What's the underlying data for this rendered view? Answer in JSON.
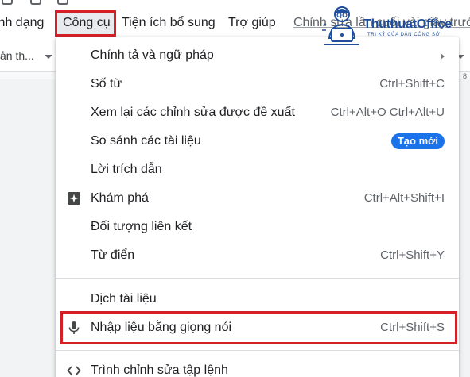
{
  "menubar": {
    "items": [
      "ịnh dạng",
      "Công cụ",
      "Tiện ích bổ sung",
      "Trợ giúp",
      "Chỉnh sửa lần cuối vài giây trước"
    ]
  },
  "toolbar": {
    "style_select": "ản th..."
  },
  "ruler": {
    "number": "8"
  },
  "menu": {
    "items": [
      {
        "label": "Chính tả và ngữ pháp",
        "shortcut": "",
        "icon": "",
        "has_submenu": true
      },
      {
        "label": "Số từ",
        "shortcut": "Ctrl+Shift+C"
      },
      {
        "label": "Xem lại các chỉnh sửa được đề xuất",
        "shortcut": "Ctrl+Alt+O Ctrl+Alt+U"
      },
      {
        "label": "So sánh các tài liệu",
        "badge": "Tạo mới"
      },
      {
        "label": "Lời trích dẫn",
        "shortcut": ""
      },
      {
        "label": "Khám phá",
        "shortcut": "Ctrl+Alt+Shift+I",
        "icon": "explore-icon"
      },
      {
        "label": "Đối tượng liên kết",
        "shortcut": ""
      },
      {
        "label": "Từ điển",
        "shortcut": "Ctrl+Shift+Y"
      },
      {
        "label": "Dịch tài liệu",
        "shortcut": ""
      },
      {
        "label": "Nhập liệu bằng giọng nói",
        "shortcut": "Ctrl+Shift+S",
        "icon": "microphone-icon"
      },
      {
        "label": "Trình chỉnh sửa tập lệnh",
        "shortcut": "",
        "icon": "code-icon"
      }
    ]
  },
  "logo": {
    "title": "ThuthuatOffice",
    "subtitle": "TRI KỶ CỦA DÂN CÔNG SỞ"
  },
  "colors": {
    "highlight": "#d62027",
    "badge": "#1a73e8",
    "logo": "#1f4e9c"
  }
}
